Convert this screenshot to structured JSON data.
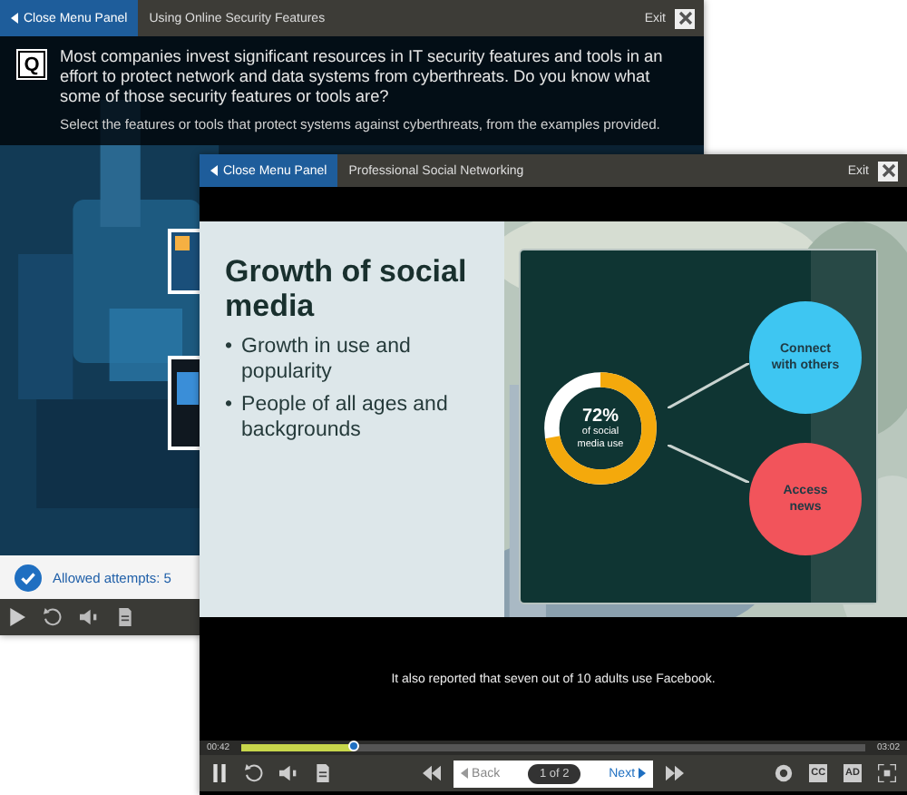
{
  "back_window": {
    "menu_button": "Close Menu Panel",
    "title": "Using Online Security Features",
    "exit": "Exit",
    "question_badge": "Q",
    "question": "Most companies invest significant resources in IT security features and tools in an effort to protect network and data systems from cyberthreats. Do you know what some of those security features or tools are?",
    "instruction": "Select the features or tools that protect systems against cyberthreats, from the examples provided.",
    "attempts": "Allowed attempts: 5",
    "playing": false
  },
  "front_window": {
    "menu_button": "Close Menu Panel",
    "title": "Professional Social Networking",
    "exit": "Exit",
    "slide": {
      "heading": "Growth of social media",
      "bullets": [
        {
          "marker": "•",
          "text": "Growth in use and popularity"
        },
        {
          "marker": "•",
          "text": "People of all ages and backgrounds"
        }
      ],
      "donut": {
        "level": 0.72,
        "value": "72%",
        "label": "of social media use"
      },
      "bubbles": [
        {
          "text": "Connect with others",
          "color": "#3ec6f2"
        },
        {
          "text": "Access news",
          "color": "#f2545b"
        }
      ]
    },
    "caption": "It also reported that seven out of 10 adults use Facebook.",
    "elapsed": "00:42",
    "total": "03:02",
    "progress": {
      "level": 0.18
    },
    "playing": true,
    "nav": {
      "back": "Back",
      "page": "1 of 2",
      "next": "Next"
    },
    "cc": "CC",
    "ad": "AD"
  }
}
